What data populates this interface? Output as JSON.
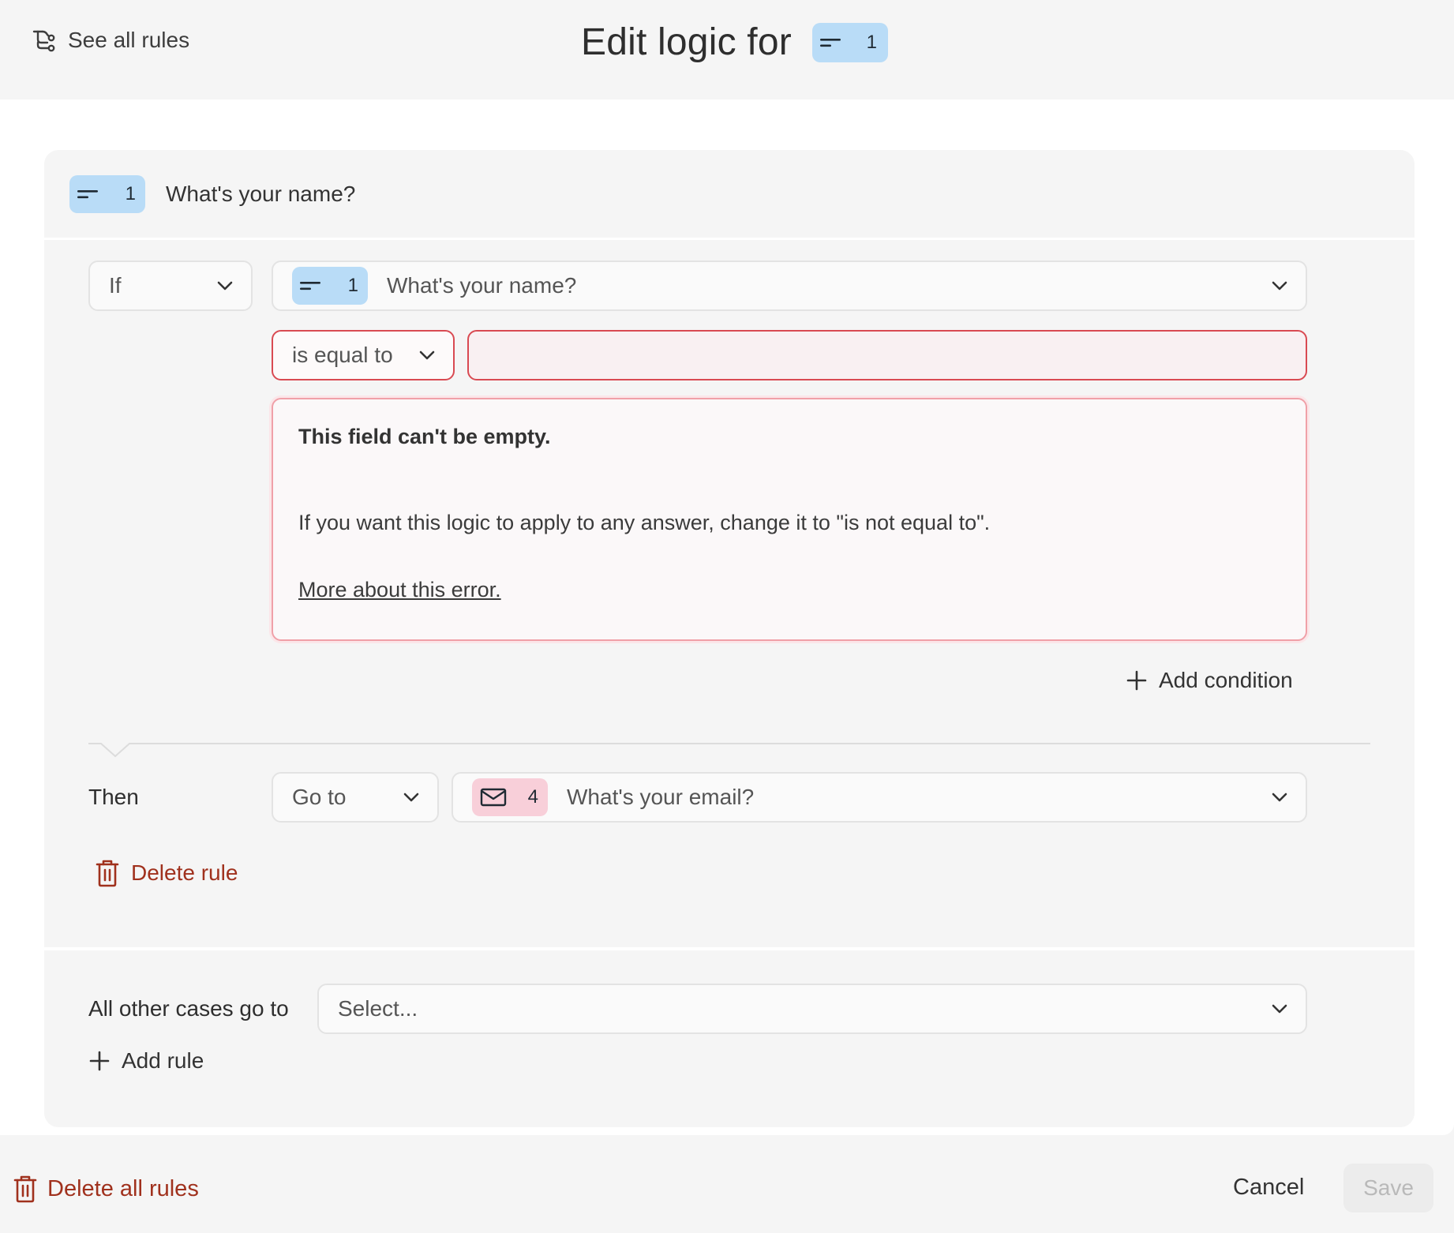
{
  "header": {
    "see_all_label": "See all rules",
    "title": "Edit logic for",
    "question_number": "1"
  },
  "rule": {
    "question_number": "1",
    "question_title": "What's your name?",
    "condition": {
      "connector": "If",
      "field_number": "1",
      "field_label": "What's your name?",
      "operator": "is equal to",
      "value": ""
    },
    "error": {
      "title": "This field can't be empty.",
      "message": "If you want this logic to apply to any answer, change it to \"is not equal to\".",
      "link": "More about this error."
    },
    "add_condition_label": "Add condition",
    "action": {
      "label": "Then",
      "type": "Go to",
      "target_number": "4",
      "target_label": "What's your email?"
    },
    "delete_rule_label": "Delete rule"
  },
  "fallback": {
    "label": "All other cases go to",
    "placeholder": "Select..."
  },
  "add_rule_label": "Add rule",
  "footer": {
    "delete_all_label": "Delete all rules",
    "cancel_label": "Cancel",
    "save_label": "Save"
  },
  "colors": {
    "short_text_badge": "#b9dcf7",
    "email_badge": "#f8cfd9",
    "danger": "#a0311d",
    "error_border": "#d94a52"
  }
}
